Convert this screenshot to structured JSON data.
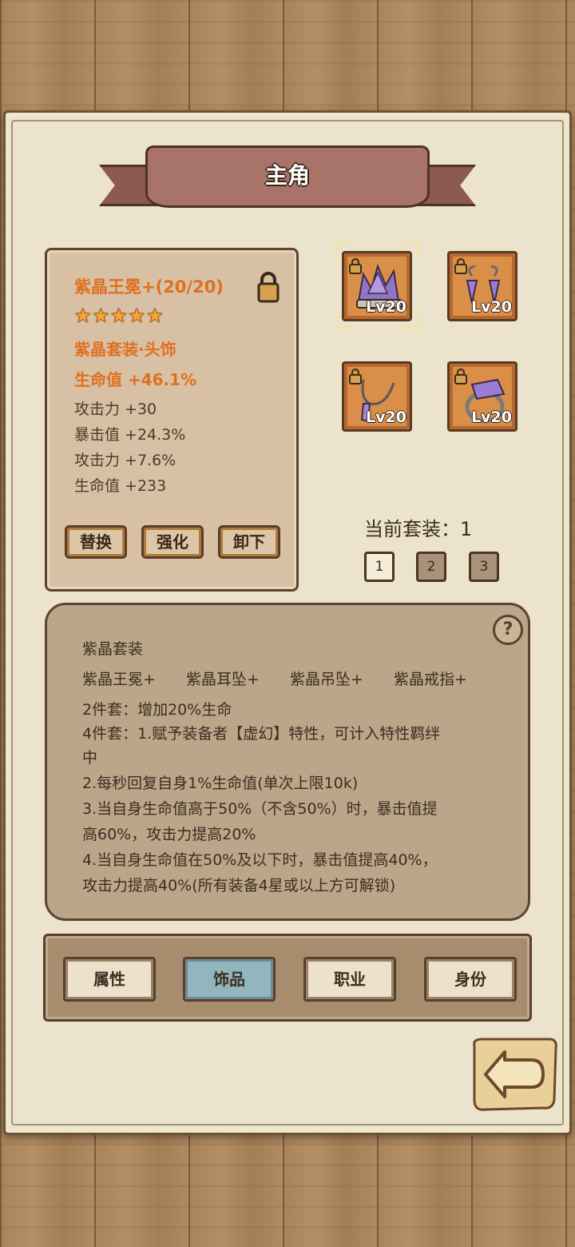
{
  "header": {
    "title": "主角"
  },
  "item": {
    "name": "紫晶王冕+(20/20)",
    "stars": "★★★★★",
    "set_label": "紫晶套装·头饰",
    "main_stat": "生命值 +46.1%",
    "sub_stats": [
      "攻击力 +30",
      "暴击值 +24.3%",
      "攻击力 +7.6%",
      "生命值 +233"
    ],
    "buttons": {
      "replace": "替换",
      "enhance": "强化",
      "unequip": "卸下"
    }
  },
  "slots": [
    {
      "name": "crown",
      "level": "Lv20"
    },
    {
      "name": "earring",
      "level": "Lv20"
    },
    {
      "name": "pendant",
      "level": "Lv20"
    },
    {
      "name": "ring",
      "level": "Lv20"
    }
  ],
  "current_set": {
    "label": "当前套装：1",
    "options": [
      "1",
      "2",
      "3"
    ],
    "selected": "1"
  },
  "set_info": {
    "title": "紫晶套装",
    "pieces": [
      "紫晶王冕+",
      "紫晶耳坠+",
      "紫晶吊坠+",
      "紫晶戒指+"
    ],
    "lines": [
      "2件套：增加20%生命",
      "4件套：1.赋予装备者【虚幻】特性，可计入特性羁绊",
      "中",
      "2.每秒回复自身1%生命值(单次上限10k)",
      "3.当自身生命值高于50%（不含50%）时，暴击值提",
      "高60%，攻击力提高20%",
      "4.当自身生命值在50%及以下时，暴击值提高40%，",
      "攻击力提高40%(所有装备4星或以上方可解锁)"
    ],
    "help": "?"
  },
  "tabs": [
    {
      "label": "属性",
      "active": false
    },
    {
      "label": "饰品",
      "active": true
    },
    {
      "label": "职业",
      "active": false
    },
    {
      "label": "身份",
      "active": false
    }
  ],
  "colors": {
    "accent_orange": "#e07020",
    "active_tab": "#93b5bd",
    "paper": "#ece3cd",
    "wood": "#a9845b"
  },
  "icons": [
    "lock-icon",
    "crown-icon",
    "earring-icon",
    "pendant-icon",
    "ring-icon",
    "help-icon",
    "back-arrow-icon"
  ]
}
